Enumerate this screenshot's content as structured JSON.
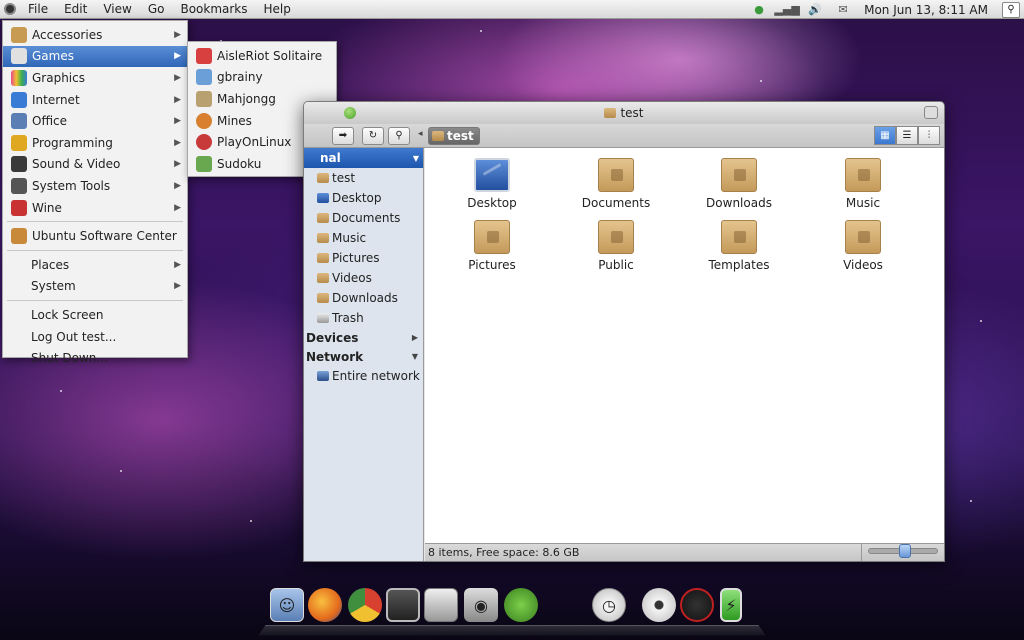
{
  "panel": {
    "menus": [
      "File",
      "Edit",
      "View",
      "Go",
      "Bookmarks",
      "Help"
    ],
    "clock": "Mon Jun 13,  8:11 AM"
  },
  "apps_menu": {
    "items": [
      {
        "label": "Accessories",
        "icon": "accessories-icon",
        "color": "#c89b52"
      },
      {
        "label": "Games",
        "icon": "games-icon",
        "color": "#e0e0e0"
      },
      {
        "label": "Graphics",
        "icon": "graphics-icon",
        "color": "#e84a8a"
      },
      {
        "label": "Internet",
        "icon": "internet-icon",
        "color": "#3a7bd5"
      },
      {
        "label": "Office",
        "icon": "office-icon",
        "color": "#5b7fb5"
      },
      {
        "label": "Programming",
        "icon": "programming-icon",
        "color": "#e0a820"
      },
      {
        "label": "Sound & Video",
        "icon": "sound-video-icon",
        "color": "#3a3a3a"
      },
      {
        "label": "System Tools",
        "icon": "system-tools-icon",
        "color": "#555555"
      },
      {
        "label": "Wine",
        "icon": "wine-icon",
        "color": "#c83232"
      }
    ],
    "software_center": "Ubuntu Software Center",
    "places": "Places",
    "system": "System",
    "lock": "Lock Screen",
    "logout": "Log Out test...",
    "shutdown": "Shut Down..."
  },
  "games_menu": {
    "items": [
      {
        "label": "AisleRiot Solitaire",
        "icon": "solitaire-icon",
        "color": "#d84040"
      },
      {
        "label": "gbrainy",
        "icon": "gbrainy-icon",
        "color": "#6a9fd8"
      },
      {
        "label": "Mahjongg",
        "icon": "mahjongg-icon",
        "color": "#b8a070"
      },
      {
        "label": "Mines",
        "icon": "mines-icon",
        "color": "#d88030"
      },
      {
        "label": "PlayOnLinux",
        "icon": "playonlinux-icon",
        "color": "#c83a3a"
      },
      {
        "label": "Sudoku",
        "icon": "sudoku-icon",
        "color": "#6aa84f"
      }
    ]
  },
  "window": {
    "title": "test",
    "crumb": "test",
    "sidebar_selected": "nal",
    "places": [
      "test",
      "Desktop",
      "Documents",
      "Music",
      "Pictures",
      "Videos",
      "Downloads",
      "Trash"
    ],
    "devices": "Devices",
    "network": "Network",
    "entire_network": "Entire network",
    "files": [
      "Desktop",
      "Documents",
      "Downloads",
      "Music",
      "Pictures",
      "Public",
      "Templates",
      "Videos"
    ],
    "status": "8 items, Free space: 8.6 GB"
  },
  "dock": {
    "icons": [
      {
        "name": "finder-icon",
        "color": "#6f8fbf"
      },
      {
        "name": "firefox-icon",
        "color": "#e46a1c"
      },
      {
        "name": "chrome-icon",
        "color": "#3f8f3f"
      },
      {
        "name": "terminal-icon",
        "color": "#3a3a3a"
      },
      {
        "name": "calculator-icon",
        "color": "#9a9a9a"
      },
      {
        "name": "camera-icon",
        "color": "#b0b0b0"
      },
      {
        "name": "pidgin-icon",
        "color": "#5c9d3a"
      },
      {
        "name": "apple-icon",
        "color": "#555555"
      },
      {
        "name": "clock-icon",
        "color": "#d0d0d0"
      },
      {
        "name": "disc-icon",
        "color": "#dcdcdc"
      },
      {
        "name": "gauge-icon",
        "color": "#202020"
      },
      {
        "name": "battery-icon",
        "color": "#4cb83a"
      }
    ]
  }
}
